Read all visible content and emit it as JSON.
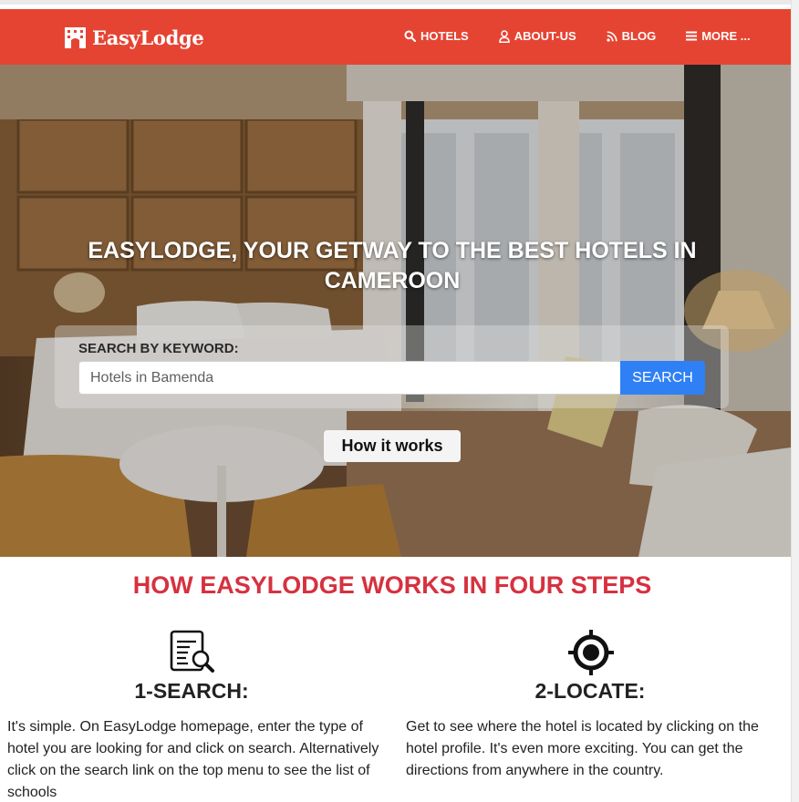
{
  "brand": {
    "name": "EasyLodge",
    "icon": "hotel-building-icon"
  },
  "nav": {
    "items": [
      {
        "label": "HOTELS",
        "icon": "search-icon"
      },
      {
        "label": "ABOUT-US",
        "icon": "user-icon"
      },
      {
        "label": "BLOG",
        "icon": "rss-icon"
      },
      {
        "label": "MORE ...",
        "icon": "menu-bars-icon"
      }
    ]
  },
  "hero": {
    "title": "EASYLODGE, YOUR GETWAY TO THE BEST HOTELS IN CAMEROON",
    "search": {
      "label": "SEARCH BY KEYWORD:",
      "placeholder": "Hotels in Bamenda",
      "button": "SEARCH"
    },
    "how_button": "How it works"
  },
  "steps_section": {
    "title": "HOW EASYLODGE WORKS IN FOUR STEPS",
    "steps": [
      {
        "icon": "document-search-icon",
        "title": "1-SEARCH:",
        "text": "It's simple. On EasyLodge homepage, enter the type of hotel you are looking for and click on search. Alternatively click on the search link on the top menu to see the list of schools"
      },
      {
        "icon": "location-target-icon",
        "title": "2-LOCATE:",
        "text": "Get to see where the hotel is located by clicking on the hotel profile. It's even more exciting. You can get the directions from anywhere in the country."
      }
    ]
  },
  "colors": {
    "navbar": "#e64433",
    "section_title": "#d6313f",
    "search_button": "#2f80f5"
  }
}
